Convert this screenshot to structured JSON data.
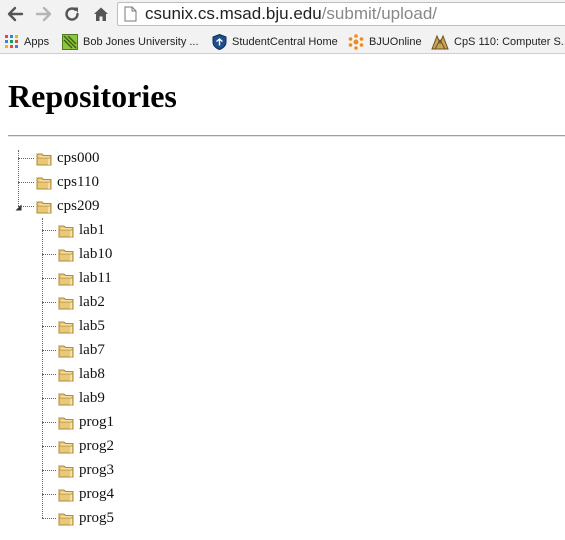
{
  "browser": {
    "url_host": "csunix.cs.msad.bju.edu",
    "url_path": "/submit/upload/",
    "bookmarks": [
      {
        "label": "Apps",
        "icon": "apps-grid-icon"
      },
      {
        "label": "Bob Jones University ...",
        "icon": "bju-bookmark-icon"
      },
      {
        "label": "StudentCentral Home",
        "icon": "shield-icon"
      },
      {
        "label": "BJUOnline",
        "icon": "bjuonline-icon"
      },
      {
        "label": "CpS 110: Computer S...",
        "icon": "cps110-icon"
      }
    ]
  },
  "page": {
    "title": "Repositories"
  },
  "tree": {
    "roots": [
      {
        "label": "cps000",
        "expanded": false
      },
      {
        "label": "cps110",
        "expanded": false
      },
      {
        "label": "cps209",
        "expanded": true,
        "children": [
          "lab1",
          "lab10",
          "lab11",
          "lab2",
          "lab5",
          "lab7",
          "lab8",
          "lab9",
          "prog1",
          "prog2",
          "prog3",
          "prog4",
          "prog5"
        ]
      }
    ]
  },
  "colors": {
    "chrome_bg": "#f2f2f2",
    "folder_fill": "#e9c877",
    "folder_stroke": "#b08a35"
  }
}
